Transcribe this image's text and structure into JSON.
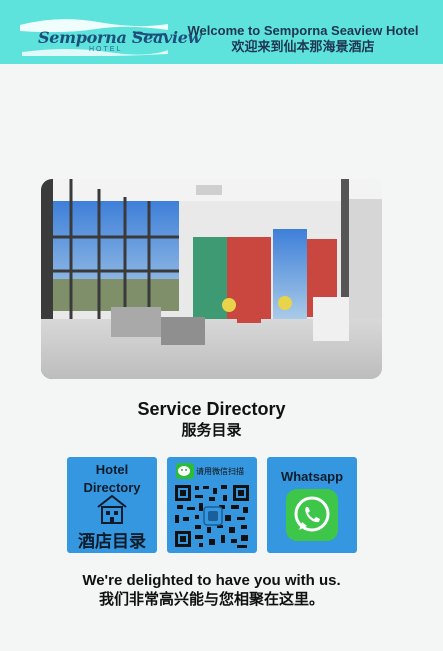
{
  "header": {
    "logo_text": "Semporna Seaview",
    "logo_sub": "HOTEL",
    "welcome_en": "Welcome to Semporna Seaview Hotel",
    "welcome_zh": "欢迎来到仙本那海景酒店",
    "bg_color": "#5ee3dc"
  },
  "service": {
    "title_en": "Service Directory",
    "title_zh": "服务目录"
  },
  "tiles": [
    {
      "label_en": "Hotel Directory",
      "label_zh": "酒店目录",
      "icon": "hotel-building-icon"
    },
    {
      "label": "请用微信扫描",
      "icon": "wechat-qr-code"
    },
    {
      "label": "Whatsapp",
      "icon": "whatsapp-icon"
    }
  ],
  "footer": {
    "line_en": "We're delighted to have you with us.",
    "line_zh": "我们非常高兴能与您相聚在这里。"
  }
}
